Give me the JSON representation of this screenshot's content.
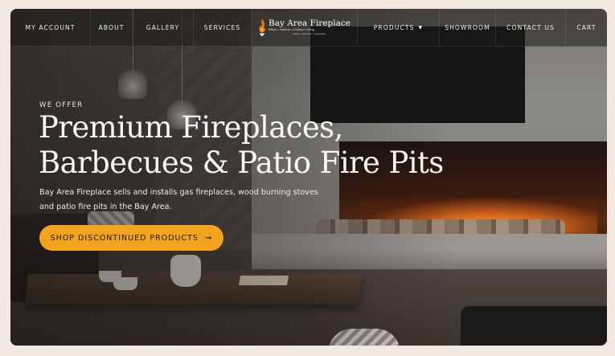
{
  "nav": {
    "left_items": [
      {
        "label": "MY ACCOUNT"
      },
      {
        "label": "ABOUT"
      },
      {
        "label": "GALLERY"
      },
      {
        "label": "SERVICES"
      }
    ],
    "logo": {
      "name": "Bay Area Fireplace",
      "tagline": "BBQs • Islands • Outdoor Living",
      "tagline2": "Sales • Service • Upgrades",
      "icon": "flame-icon"
    },
    "right_items": [
      {
        "label": "PRODUCTS",
        "icon": "caret-down-icon"
      },
      {
        "label": "SHOWROOM"
      },
      {
        "label": "CONTACT US"
      },
      {
        "label": "CART"
      }
    ]
  },
  "hero": {
    "kicker": "WE OFFER",
    "headline_line1": "Premium Fireplaces,",
    "headline_line2": "Barbecues & Patio Fire Pits",
    "description": "Bay Area Fireplace sells and installs gas fireplaces, wood burning stoves and patio fire pits in the Bay Area.",
    "cta_label": "SHOP DISCONTINUED PRODUCTS",
    "cta_icon": "arrow-right-icon"
  },
  "colors": {
    "page_background": "#f1e9df",
    "cta_background": "#f3a41c",
    "nav_text": "#f3efe9"
  }
}
